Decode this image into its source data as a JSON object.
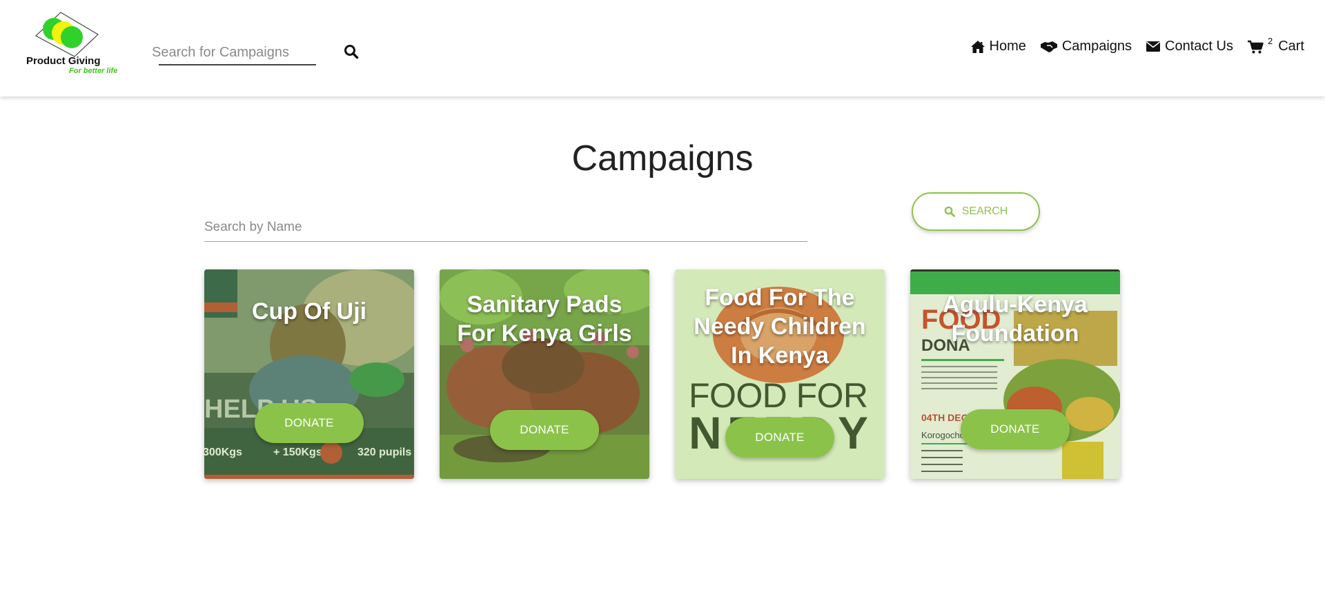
{
  "header": {
    "logo": {
      "name": "Product Giving",
      "tagline": "For better life"
    },
    "search": {
      "placeholder": "Search for Campaigns"
    },
    "nav": {
      "home": "Home",
      "campaigns": "Campaigns",
      "contact": "Contact Us",
      "cart_count": "2",
      "cart": "Cart"
    }
  },
  "main": {
    "title": "Campaigns",
    "name_search": {
      "placeholder": "Search by Name"
    },
    "search_button": "SEARCH",
    "cards": [
      {
        "title": "Cup Of Uji",
        "button": "DONATE"
      },
      {
        "title": "Sanitary Pads For Kenya Girls",
        "button": "DONATE"
      },
      {
        "title": "Food For The Needy Children In Kenya",
        "button": "DONATE"
      },
      {
        "title": "Agulu-Kenya Foundation",
        "button": "DONATE"
      }
    ]
  },
  "colors": {
    "accent": "#8bc34a",
    "logo_green": "#3fc21a",
    "logo_yellow": "#f2f20c"
  }
}
